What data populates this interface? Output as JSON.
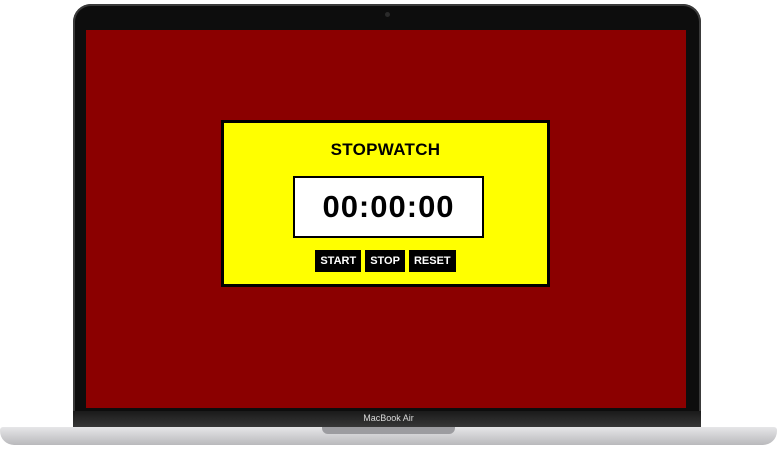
{
  "device": {
    "model_label": "MacBook Air"
  },
  "stopwatch": {
    "title": "STOPWATCH",
    "time_display": "00:00:00",
    "buttons": {
      "start": "START",
      "stop": "STOP",
      "reset": "RESET"
    }
  },
  "colors": {
    "page_background": "#8b0000",
    "panel_background": "#ffff00",
    "button_background": "#000000",
    "button_text": "#ffffff"
  }
}
